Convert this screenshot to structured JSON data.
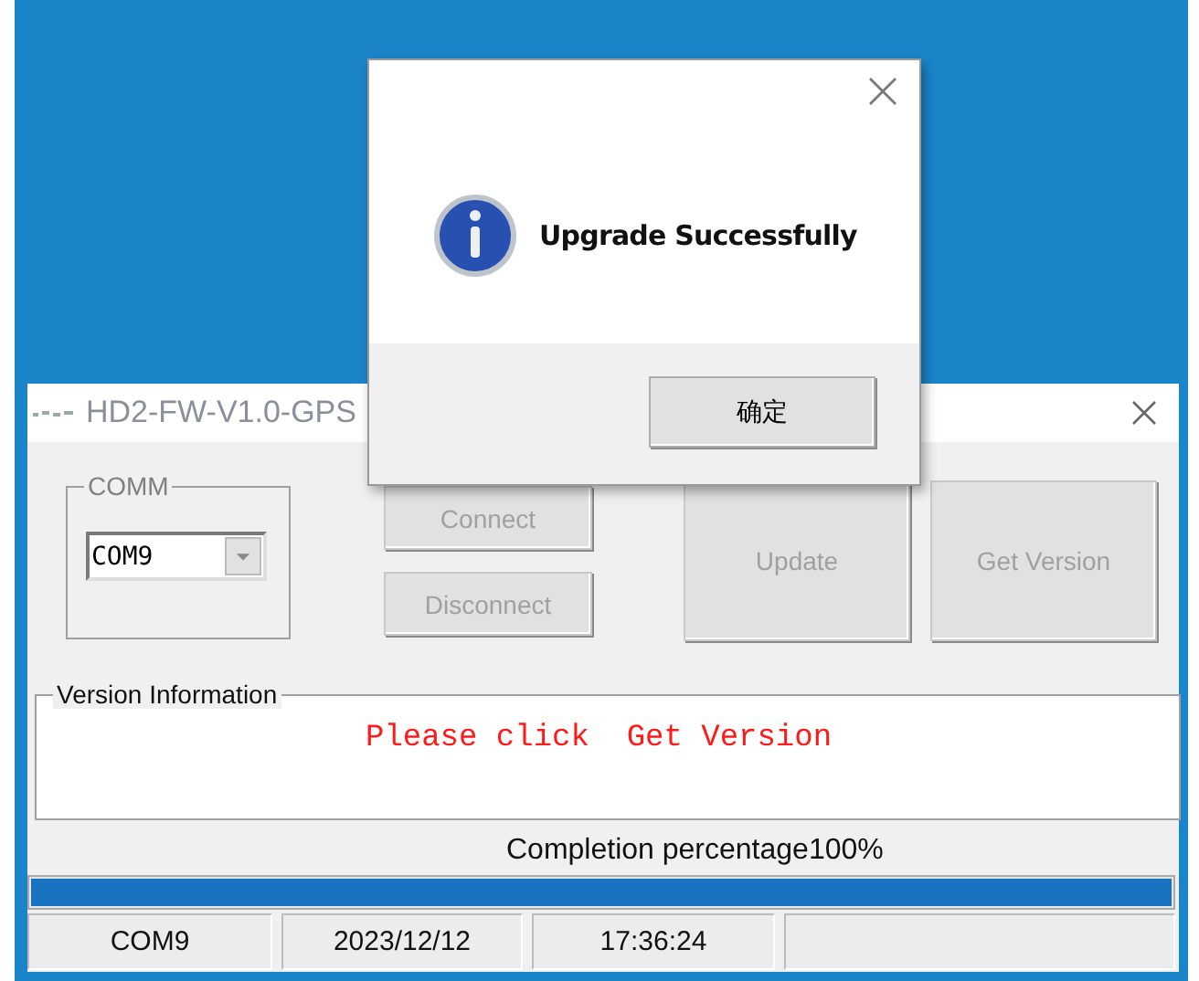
{
  "app_window": {
    "title": "HD2-FW-V1.0-GPS"
  },
  "comm": {
    "label": "COMM",
    "port": "COM9"
  },
  "connection_buttons": [
    {
      "label": "Connect",
      "disabled": true
    },
    {
      "label": "Disconnect",
      "disabled": true
    }
  ],
  "action_buttons": [
    {
      "label": "Update",
      "disabled": true
    },
    {
      "label": "Get Version",
      "disabled": true
    }
  ],
  "version_info": {
    "label": "Version Information",
    "message": "Please click  Get Version"
  },
  "progress": {
    "label": "Completion percentage100%",
    "level": 1.0
  },
  "status_bar": [
    "COM9",
    "2023/12/12",
    "17:36:24"
  ],
  "dialog": {
    "message": "Upgrade Successfully",
    "button": "确定"
  }
}
